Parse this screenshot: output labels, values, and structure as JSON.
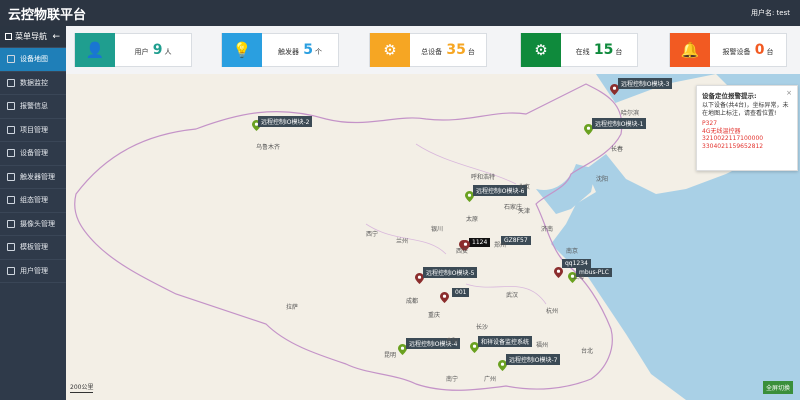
{
  "app": {
    "title": "云控物联平台",
    "user": "用户名: test"
  },
  "sidebar": {
    "header": "菜单导航",
    "back": "←",
    "items": [
      {
        "label": "设备地图",
        "active": true
      },
      {
        "label": "数据监控"
      },
      {
        "label": "报警信息"
      },
      {
        "label": "项目管理"
      },
      {
        "label": "设备管理"
      },
      {
        "label": "触发器管理"
      },
      {
        "label": "组态管理"
      },
      {
        "label": "摄像头管理"
      },
      {
        "label": "模板管理"
      },
      {
        "label": "用户管理"
      }
    ]
  },
  "cards": [
    {
      "label": "用户",
      "value": "9",
      "unit": "人",
      "icon": "user-icon",
      "color": "#1f9e8f",
      "num_color": "#1f9e8f"
    },
    {
      "label": "触发器",
      "value": "5",
      "unit": "个",
      "icon": "bulb-icon",
      "color": "#2a9fe0",
      "num_color": "#2a9fe0"
    },
    {
      "label": "总设备",
      "value": "35",
      "unit": "台",
      "icon": "gear-icon",
      "color": "#f6a623",
      "num_color": "#f6a623"
    },
    {
      "label": "在线",
      "value": "15",
      "unit": "台",
      "icon": "gear-icon",
      "color": "#0f8a3c",
      "num_color": "#0f8a3c"
    },
    {
      "label": "报警设备",
      "value": "0",
      "unit": "台",
      "icon": "bell-icon",
      "color": "#f25a22",
      "num_color": "#f25a22"
    }
  ],
  "map": {
    "markers": [
      {
        "label": "远程控制IO模块-3",
        "color": "#8b2d2d"
      },
      {
        "label": "远程控制IO模块-2",
        "color": "#6aa120"
      },
      {
        "label": "远程控制IO模块-1",
        "color": "#6aa120"
      },
      {
        "label": "远程控制IO模块-6",
        "color": "#6aa120"
      },
      {
        "label": "1124",
        "color": "#8b2d2d"
      },
      {
        "label": "GZ8F57",
        "color": "#8b2d2d"
      },
      {
        "label": "远程控制IO模块-5",
        "color": "#8b2d2d"
      },
      {
        "label": "001",
        "color": "#8b2d2d"
      },
      {
        "label": "qq1234",
        "color": "#8b2d2d"
      },
      {
        "label": "mbus-PLC",
        "color": "#6aa120"
      },
      {
        "label": "远程控制IO模块-4",
        "color": "#6aa120"
      },
      {
        "label": "和祥设备监控系统",
        "color": "#6aa120"
      },
      {
        "label": "远程控制IO模块-7",
        "color": "#6aa120"
      }
    ],
    "cities": [
      "乌鲁木齐",
      "哈尔滨",
      "长春",
      "沈阳",
      "北京",
      "天津",
      "呼和浩特",
      "石家庄",
      "济南",
      "太原",
      "银川",
      "西宁",
      "兰州",
      "西安",
      "郑州",
      "南京",
      "上海",
      "成都",
      "武汉",
      "杭州",
      "重庆",
      "拉萨",
      "长沙",
      "贵阳",
      "福州",
      "昆明",
      "广州",
      "南宁",
      "台北"
    ],
    "scale": "200公里",
    "fullscreen": "全屏切换"
  },
  "alert": {
    "title": "设备定位报警提示:",
    "close": "×",
    "body": "以下设备(共4台)，坐标异常，未在地图上标注，请查看位置!",
    "devices": [
      "P327",
      "4G无线温控器",
      "3210022117100000",
      "3304021159652812"
    ]
  }
}
